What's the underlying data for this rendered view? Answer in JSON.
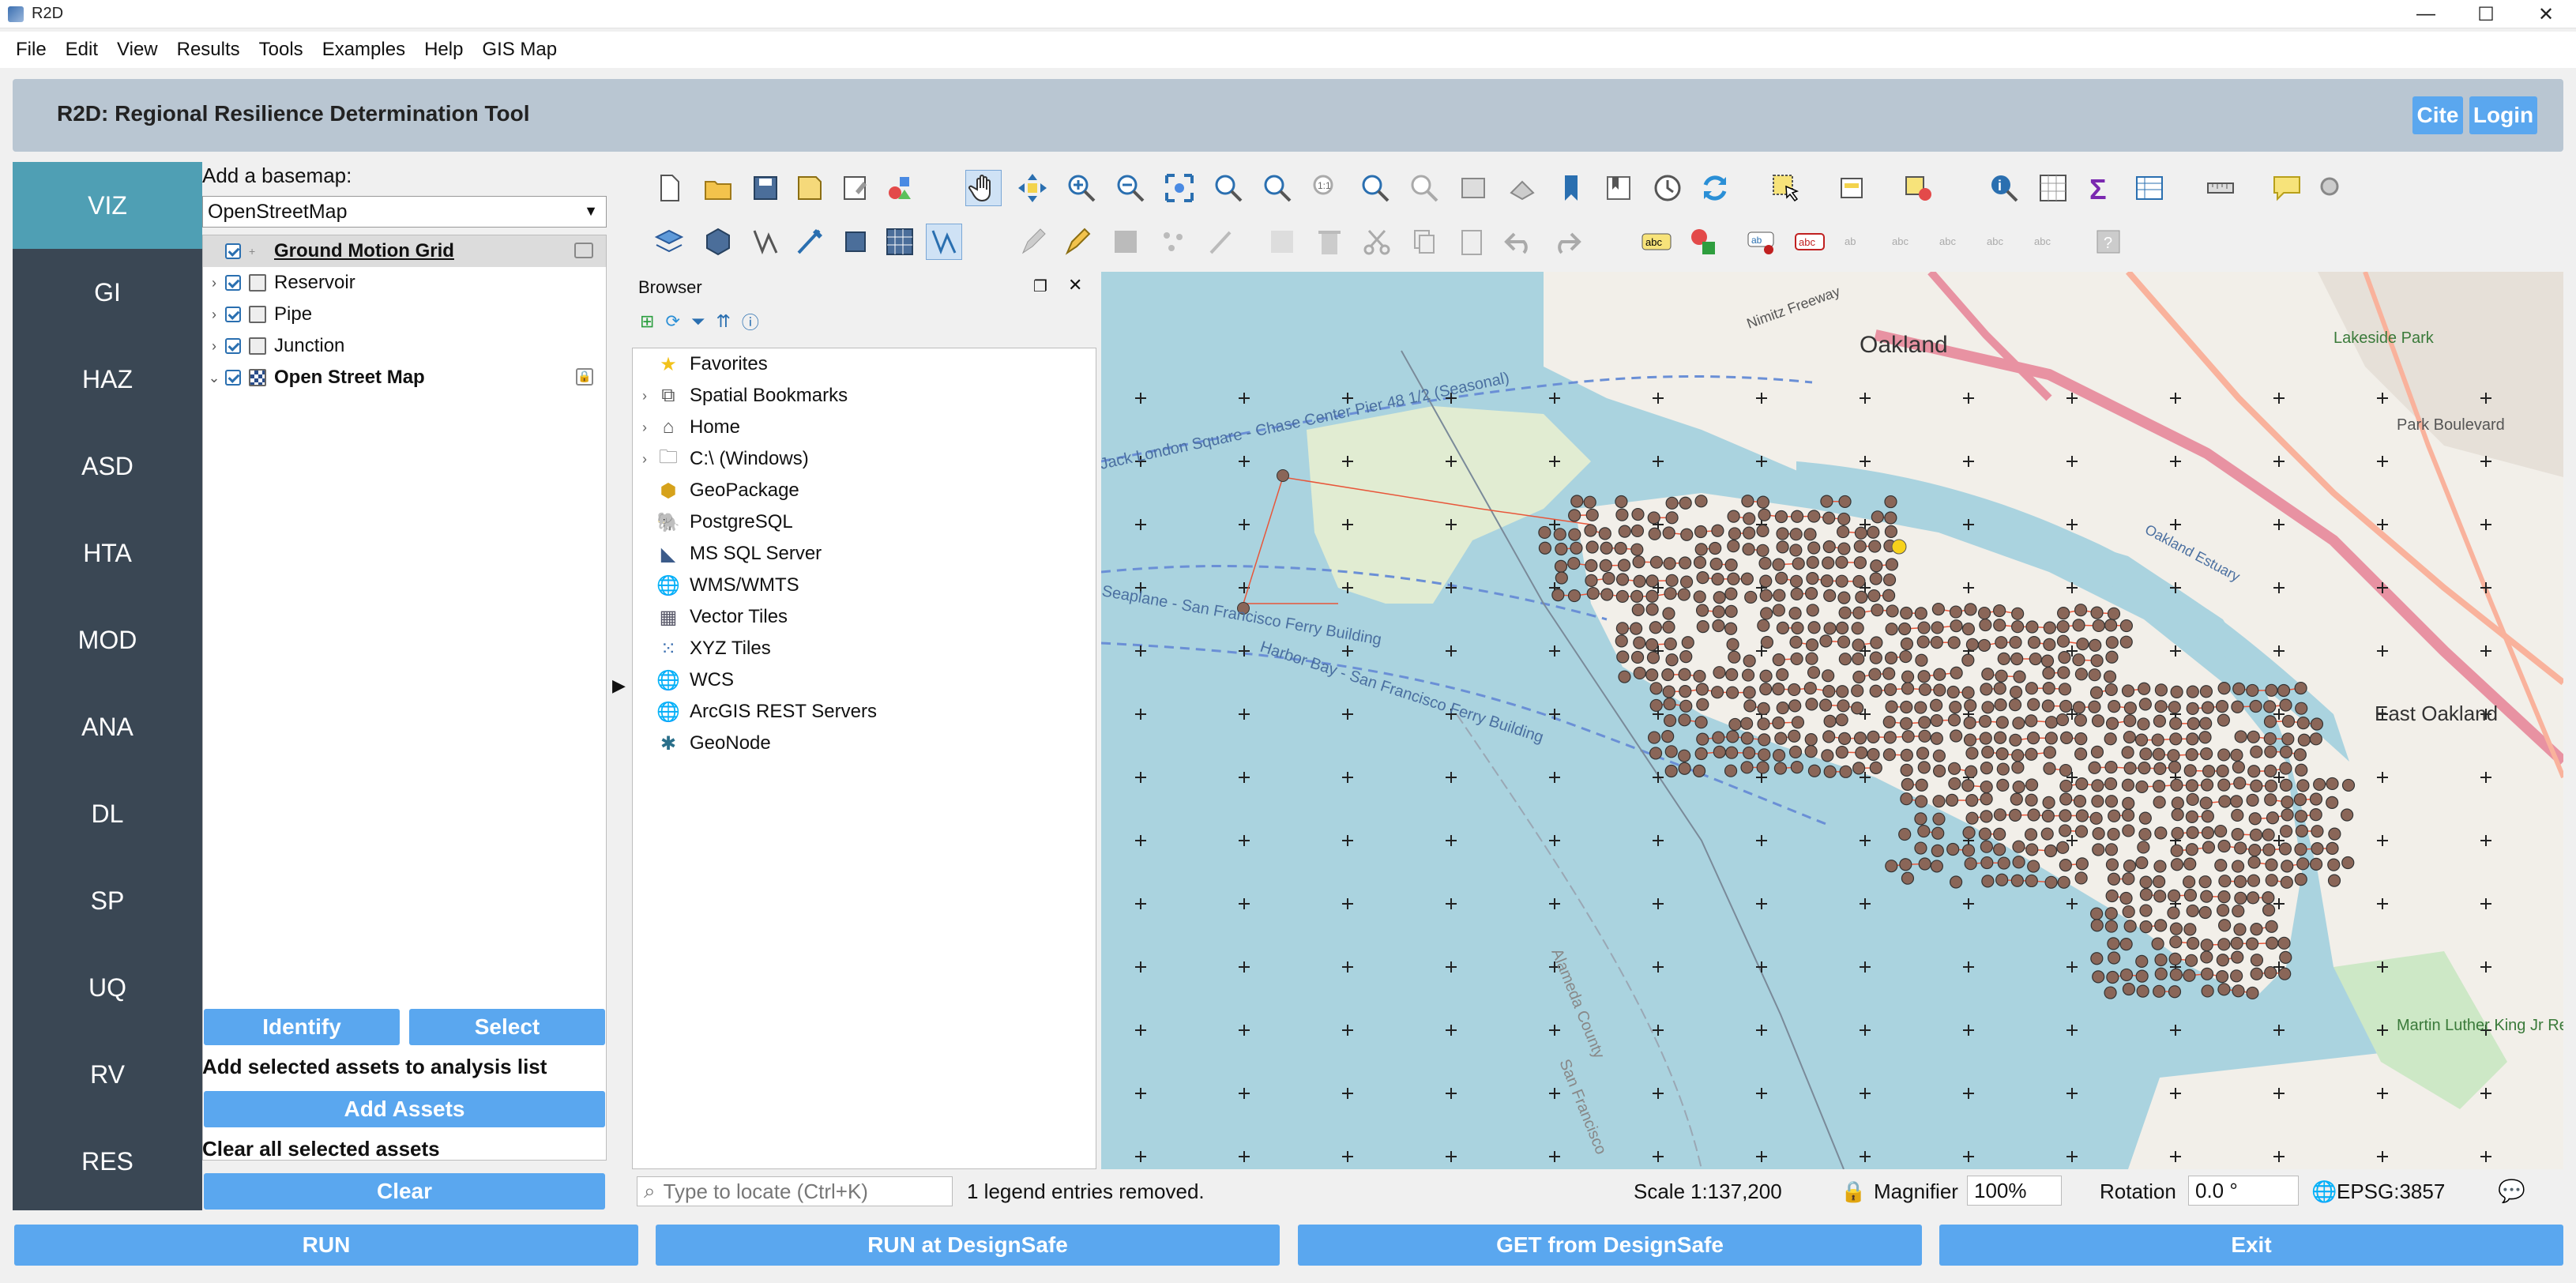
{
  "window": {
    "title": "R2D",
    "minimize": "—",
    "maximize": "☐",
    "close": "✕"
  },
  "menu": [
    "File",
    "Edit",
    "View",
    "Results",
    "Tools",
    "Examples",
    "Help",
    "GIS Map"
  ],
  "header": {
    "title": "R2D: Regional Resilience Determination Tool",
    "cite": "Cite",
    "login": "Login"
  },
  "nav": [
    "VIZ",
    "GI",
    "HAZ",
    "ASD",
    "HTA",
    "MOD",
    "ANA",
    "DL",
    "SP",
    "UQ",
    "RV",
    "RES"
  ],
  "nav_active": "VIZ",
  "layers": {
    "basemap_label": "Add a basemap:",
    "basemap_value": "OpenStreetMap",
    "items": [
      {
        "name": "Ground Motion Grid",
        "bold": true,
        "underline": true
      },
      {
        "name": "Reservoir"
      },
      {
        "name": "Pipe"
      },
      {
        "name": "Junction"
      },
      {
        "name": "Open Street Map",
        "bold": true
      }
    ],
    "identify": "Identify",
    "select": "Select",
    "add_label": "Add selected assets to analysis list",
    "add_button": "Add Assets",
    "clear_label": "Clear all selected assets",
    "clear_button": "Clear"
  },
  "browser": {
    "title": "Browser",
    "items": [
      {
        "label": "Favorites",
        "icon": "star-icon",
        "expandable": false
      },
      {
        "label": "Spatial Bookmarks",
        "icon": "bookmark-icon",
        "expandable": true
      },
      {
        "label": "Home",
        "icon": "home-icon",
        "expandable": true
      },
      {
        "label": "C:\\ (Windows)",
        "icon": "folder-icon",
        "expandable": true
      },
      {
        "label": "GeoPackage",
        "icon": "geopackage-icon",
        "expandable": false
      },
      {
        "label": "PostgreSQL",
        "icon": "postgresql-icon",
        "expandable": false
      },
      {
        "label": "MS SQL Server",
        "icon": "mssql-icon",
        "expandable": false
      },
      {
        "label": "WMS/WMTS",
        "icon": "wms-icon",
        "expandable": false
      },
      {
        "label": "Vector Tiles",
        "icon": "vector-tiles-icon",
        "expandable": false
      },
      {
        "label": "XYZ Tiles",
        "icon": "xyz-tiles-icon",
        "expandable": false
      },
      {
        "label": "WCS",
        "icon": "wcs-icon",
        "expandable": false
      },
      {
        "label": "ArcGIS REST Servers",
        "icon": "arcgis-icon",
        "expandable": false
      },
      {
        "label": "GeoNode",
        "icon": "geonode-icon",
        "expandable": false
      }
    ]
  },
  "map": {
    "labels": {
      "oakland": "Oakland",
      "east_oakland": "East Oakland",
      "lakeside_park": "Lakeside Park",
      "park_blvd": "Park Boulevard",
      "mlk": "Martin Luther King Jr Regional Shoreline",
      "estuary": "Oakland Estuary",
      "ferry": "Harbor Bay - San Francisco Ferry Building",
      "seaplane": "Seaplane - San Francisco Ferry Building",
      "jack_london": "Jack London Square - Chase Center Pier 48 1/2 (Seasonal)",
      "nimitz": "Nimitz Freeway",
      "alameda_county": "Alameda County",
      "san_francisco": "San Francisco"
    },
    "colors": {
      "water": "#aad3df",
      "land": "#f2efe9",
      "node": "#8a6658",
      "pipe": "#e8563a",
      "highway": "#e892a2"
    }
  },
  "status": {
    "locate_placeholder": "Type to locate (Ctrl+K)",
    "message": "1 legend entries removed.",
    "scale_label": "Scale",
    "scale_value": "1:137,200",
    "magnifier_label": "Magnifier",
    "magnifier_value": "100%",
    "rotation_label": "Rotation",
    "rotation_value": "0.0 °",
    "crs": "EPSG:3857"
  },
  "bottom": {
    "run": "RUN",
    "run_ds": "RUN at DesignSafe",
    "get_ds": "GET from DesignSafe",
    "exit": "Exit"
  }
}
